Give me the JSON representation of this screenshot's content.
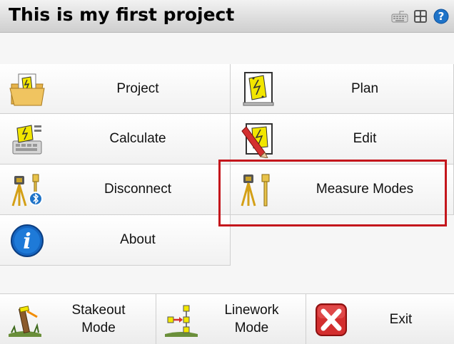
{
  "title": "This is my first project",
  "toolbar": {
    "icons": [
      "keyboard-icon",
      "grid-icon",
      "help-icon"
    ]
  },
  "menu": {
    "project": "Project",
    "plan": "Plan",
    "calculate": "Calculate",
    "edit": "Edit",
    "disconnect": "Disconnect",
    "measure_modes": "Measure Modes",
    "about": "About"
  },
  "bottom": {
    "stakeout_line1": "Stakeout",
    "stakeout_line2": "Mode",
    "linework_line1": "Linework",
    "linework_line2": "Mode",
    "exit": "Exit"
  },
  "colors": {
    "highlight": "#c4161c",
    "accent_yellow": "#f2e600",
    "about_blue": "#1565c0"
  }
}
